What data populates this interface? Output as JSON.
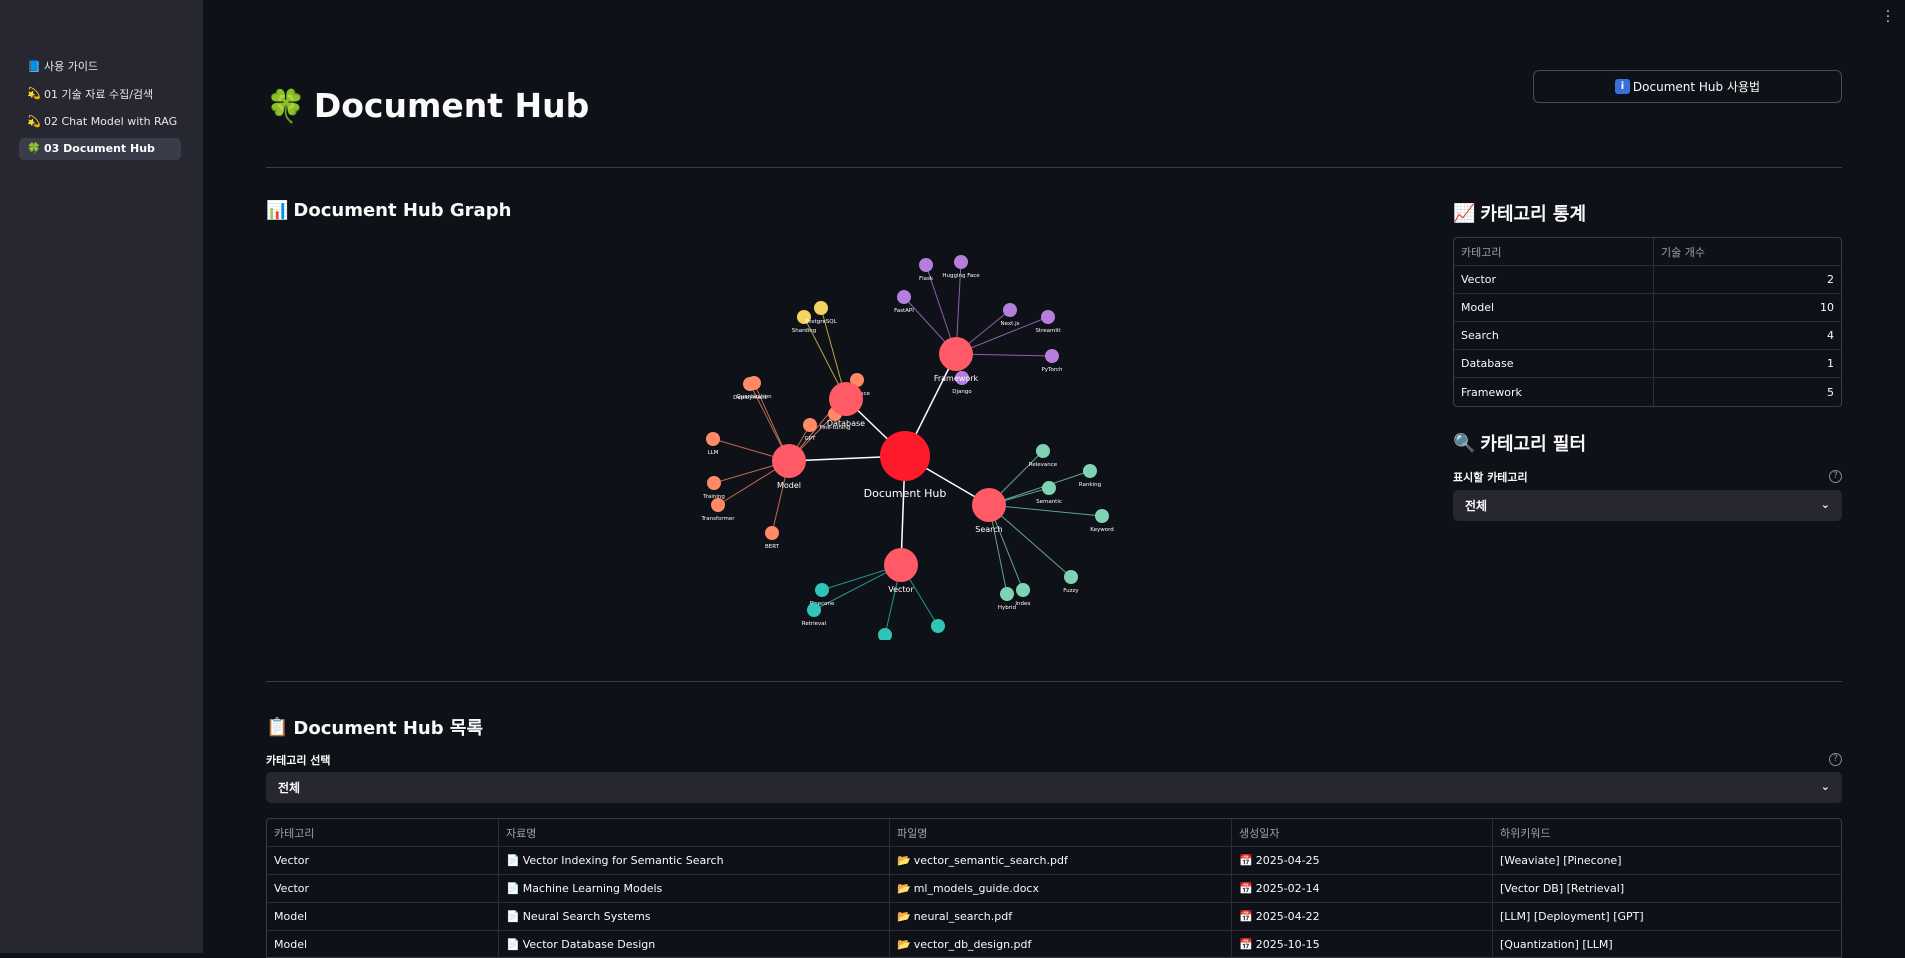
{
  "sidebar": {
    "items": [
      {
        "icon": "📘",
        "label": "사용 가이드"
      },
      {
        "icon": "💫",
        "label": "01 기술 자료 수집/검색"
      },
      {
        "icon": "💫",
        "label": "02 Chat Model with RAG"
      },
      {
        "icon": "🍀",
        "label": "03 Document Hub"
      }
    ],
    "active_index": 3
  },
  "header": {
    "title": "Document Hub",
    "title_icon": "🍀",
    "help_button": "Document Hub 사용법",
    "help_icon": "ℹ️"
  },
  "graph_section": {
    "title": "Document Hub Graph",
    "icon": "📊"
  },
  "stats_section": {
    "title": "카테고리 통계",
    "icon": "📈",
    "columns": [
      "카테고리",
      "기술 개수"
    ],
    "rows": [
      {
        "category": "Vector",
        "count": "2"
      },
      {
        "category": "Model",
        "count": "10"
      },
      {
        "category": "Search",
        "count": "4"
      },
      {
        "category": "Database",
        "count": "1"
      },
      {
        "category": "Framework",
        "count": "5"
      }
    ]
  },
  "filter_section": {
    "title": "카테고리 필터",
    "icon": "🔍",
    "label": "표시할 카테고리",
    "value": "전체"
  },
  "list_section": {
    "title": "Document Hub 목록",
    "icon": "📋",
    "select_label": "카테고리 선택",
    "select_value": "전체",
    "columns": [
      "카테고리",
      "자료명",
      "파일명",
      "생성일자",
      "하위키워드"
    ],
    "rows": [
      {
        "category": "Vector",
        "name": "Vector Indexing for Semantic Search",
        "file": "vector_semantic_search.pdf",
        "date": "2025-04-25",
        "keywords": "[Weaviate] [Pinecone]"
      },
      {
        "category": "Vector",
        "name": "Machine Learning Models",
        "file": "ml_models_guide.docx",
        "date": "2025-02-14",
        "keywords": "[Vector DB] [Retrieval]"
      },
      {
        "category": "Model",
        "name": "Neural Search Systems",
        "file": "neural_search.pdf",
        "date": "2025-04-22",
        "keywords": "[LLM] [Deployment] [GPT]"
      },
      {
        "category": "Model",
        "name": "Vector Database Design",
        "file": "vector_db_design.pdf",
        "date": "2025-10-15",
        "keywords": "[Quantization] [LLM]"
      }
    ]
  },
  "graph": {
    "center": {
      "label": "Document Hub",
      "color": "#ff1a2b"
    },
    "categories": [
      {
        "label": "Model",
        "color": "#ff5a65"
      },
      {
        "label": "Database",
        "color": "#ff5a65"
      },
      {
        "label": "Framework",
        "color": "#ff5a65"
      },
      {
        "label": "Search",
        "color": "#ff5a65"
      },
      {
        "label": "Vector",
        "color": "#ff5a65"
      }
    ],
    "leaves": {
      "Model": {
        "color": "#ff8a65",
        "items": [
          "LLM",
          "Training",
          "Transformer",
          "BERT",
          "GPT",
          "Fine-tuning",
          "Deployment",
          "Quantization",
          "Inference"
        ]
      },
      "Database": {
        "color": "#f4d35e",
        "items": [
          "Sharding",
          "PostgreSQL"
        ]
      },
      "Framework": {
        "color": "#b57edc",
        "items": [
          "Flask",
          "Hugging Face",
          "FastAPI",
          "Next.js",
          "Streamlit",
          "PyTorch",
          "Django"
        ]
      },
      "Search": {
        "color": "#7fd3b4",
        "items": [
          "Relevance",
          "Ranking",
          "Semantic",
          "Keyword",
          "Fuzzy",
          "Index",
          "Hybrid"
        ]
      },
      "Vector": {
        "color": "#2ec4b6",
        "items": [
          "Pinecone",
          "Retrieval",
          "",
          ""
        ]
      }
    }
  }
}
